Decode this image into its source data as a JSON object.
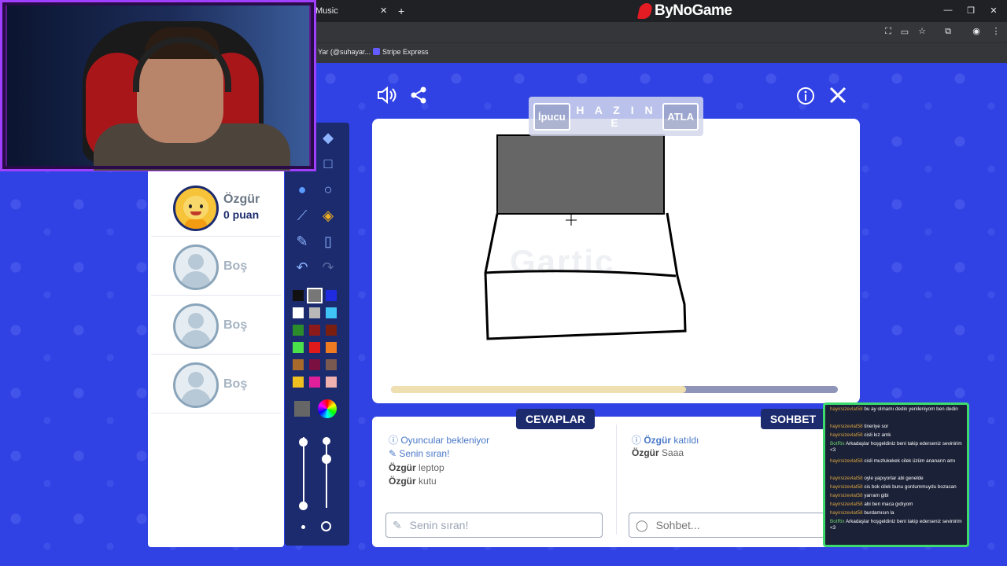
{
  "browser": {
    "tab_title": "Music",
    "site_brand": "ByNoGame",
    "bookmarks": [
      "Yar (@suhayar...",
      "Stripe Express"
    ]
  },
  "game": {
    "hint_label": "İpucu",
    "skip_label": "ATLA",
    "word": "H A Z I N E",
    "watermark": "Gartic"
  },
  "players": [
    {
      "name": "Özgür",
      "score": "0 puan"
    },
    {
      "name": "Boş"
    },
    {
      "name": "Boş"
    },
    {
      "name": "Boş"
    }
  ],
  "colors": {
    "palette": [
      "#111111",
      "#777777",
      "#1f2be0",
      "#ffffff",
      "#b8b8b8",
      "#3fc4f5",
      "#2a8c2a",
      "#8c1a1a",
      "#7a1f10",
      "#4be14b",
      "#e01a1a",
      "#f07a20",
      "#a86a2a",
      "#7a1040",
      "#7a5a50",
      "#f0c020",
      "#e0209a",
      "#f0b0b0"
    ],
    "selected_color": "#777777"
  },
  "progress": 0.66,
  "answers": {
    "header": "CEVAPLAR",
    "lines": [
      {
        "user": "",
        "text": "Oyuncular bekleniyor",
        "kind": "info"
      },
      {
        "user": "",
        "text": "Senin sıran!",
        "kind": "turn"
      },
      {
        "user": "Özgür",
        "text": "leptop"
      },
      {
        "user": "Özgür",
        "text": "kutu"
      }
    ],
    "input_placeholder": "Senin sıran!"
  },
  "chat": {
    "header": "SOHBET",
    "lines": [
      {
        "user": "Özgür",
        "text": "katıldı",
        "kind": "join"
      },
      {
        "user": "Özgür",
        "text": "Saaa"
      }
    ],
    "input_placeholder": "Sohbet..."
  },
  "stream_chat": [
    {
      "user": "hayirsizevlat58",
      "text": "bu ay olmamı dedin yenileniyom ben dedin"
    },
    {
      "user": "hayirsizevlat58",
      "text": "tineriye sor"
    },
    {
      "user": "hayirsizevlat58",
      "text": "cisli kız amk"
    },
    {
      "user": "BotRix",
      "text": "Arkadaşlar hoşgeldiniz beni takip ederseniz sevinirim <3",
      "bot": true
    },
    {
      "user": "hayirsizevlat58",
      "text": "cisli muzlukekek cilek üzüm ananarın amı"
    },
    {
      "user": "hayirsizevlat58",
      "text": "oyle yapıyorlar abi genelde"
    },
    {
      "user": "hayirsizevlat58",
      "text": "cis bok cilek bunu gordummuydu bozacan"
    },
    {
      "user": "hayirsizevlat58",
      "text": "yarram gibi"
    },
    {
      "user": "hayirsizevlat58",
      "text": "abi ben maca gıdıyom"
    },
    {
      "user": "hayirsizevlat58",
      "text": "burdamısın la"
    },
    {
      "user": "BotRix",
      "text": "Arkadaşlar hoşgeldiniz beni takip ederseniz sevinirim <3",
      "bot": true
    }
  ]
}
